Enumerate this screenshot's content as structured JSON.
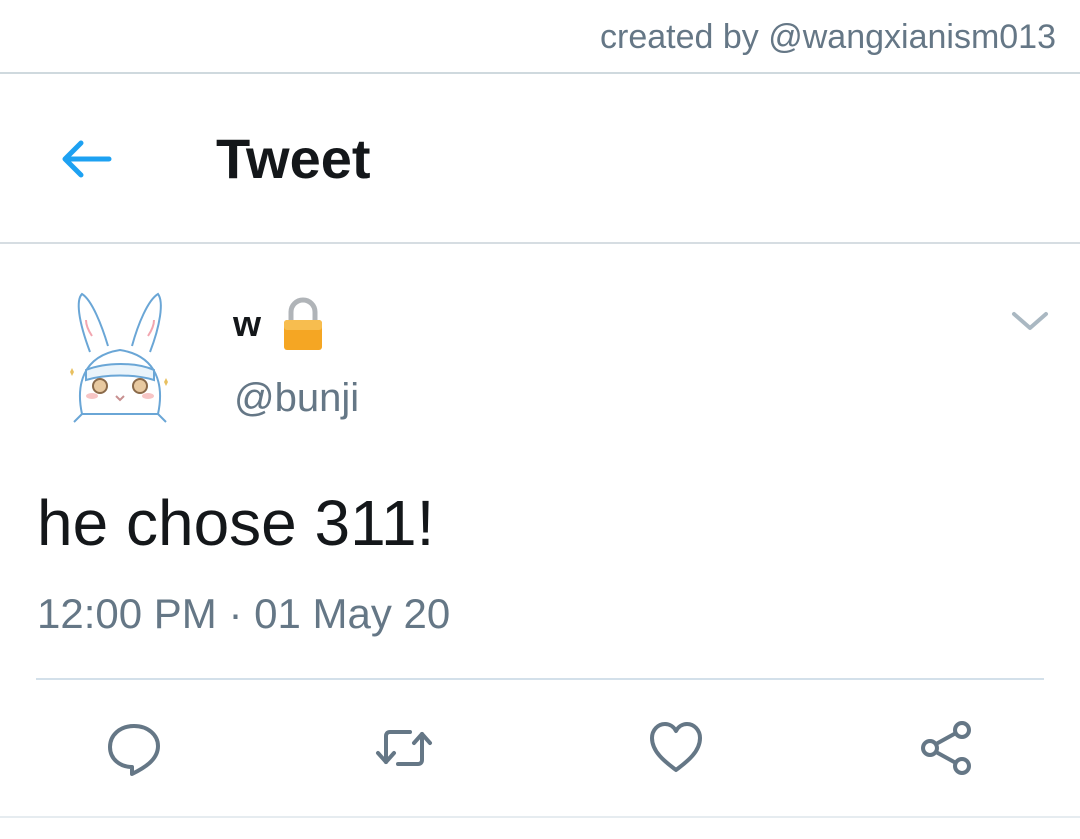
{
  "credit": {
    "text": "created by @wangxianism013"
  },
  "header": {
    "title": "Tweet",
    "back_icon": "back-arrow-icon"
  },
  "tweet": {
    "author": {
      "display_name": "w",
      "handle": "@bunji",
      "protected_icon": "lock-icon",
      "avatar_icon": "bunny-avatar"
    },
    "text": "he chose 311!",
    "timestamp": "12:00 PM · 01 May 20",
    "menu_icon": "chevron-down-icon",
    "actions": [
      {
        "name": "reply",
        "icon": "reply-icon"
      },
      {
        "name": "retweet",
        "icon": "retweet-icon"
      },
      {
        "name": "like",
        "icon": "heart-icon"
      },
      {
        "name": "share",
        "icon": "share-icon"
      }
    ]
  },
  "colors": {
    "accent": "#1da1f2",
    "text_primary": "#14171a",
    "text_secondary": "#657786",
    "divider": "#d6dde2",
    "lock": "#f5a623"
  }
}
